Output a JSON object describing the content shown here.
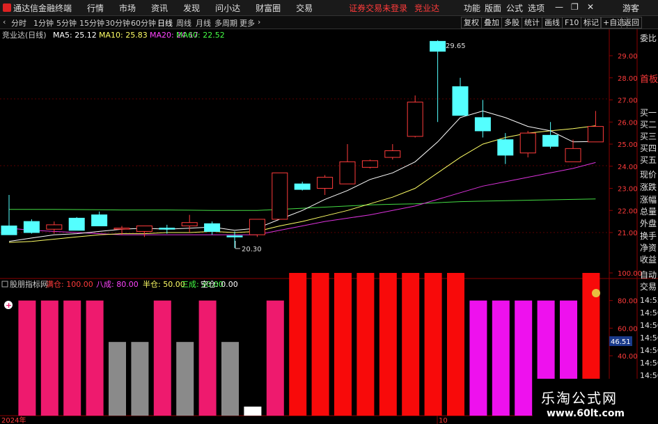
{
  "menubar": {
    "app_title": "通达信金融终端",
    "menus": [
      "行情",
      "市场",
      "资讯",
      "发现",
      "问小达",
      "财富圈",
      "交易"
    ],
    "warning": "证券交易未登录",
    "stock_name": "竞业达",
    "right_menus": [
      "功能",
      "版面",
      "公式",
      "选项"
    ],
    "guest": "游客"
  },
  "toolbar": {
    "periods": [
      "分时",
      "1分钟",
      "5分钟",
      "15分钟",
      "30分钟",
      "60分钟",
      "日线",
      "周线",
      "月线",
      "多周期",
      "更多"
    ],
    "active_period": "日线",
    "right_buttons": [
      "复权",
      "叠加",
      "多股",
      "统计",
      "画线",
      "F10",
      "标记",
      "+自选",
      "返回"
    ]
  },
  "main_chart": {
    "title": "竞业达(日线)",
    "ma": [
      {
        "label": "MA5: 25.12",
        "color": "#ffffff"
      },
      {
        "label": "MA10: 25.83",
        "color": "#ffff66"
      },
      {
        "label": "MA20: 24.17",
        "color": "#ff44ff"
      },
      {
        "label": "MA60: 22.52",
        "color": "#44ff44"
      }
    ],
    "price_ticks": [
      "29.00",
      "28.00",
      "27.00",
      "26.00",
      "25.00",
      "24.00",
      "23.00",
      "22.00",
      "21.00"
    ],
    "high_label": "29.65",
    "low_label": "20.30"
  },
  "indicator": {
    "name": "股朋指标网",
    "items": [
      {
        "label": "满仓: 100.00",
        "color": "#ff3b3b"
      },
      {
        "label": "八成: 80.00",
        "color": "#ff44ff"
      },
      {
        "label": "半仓: 50.00",
        "color": "#ffff66"
      },
      {
        "label": "三成: 30.00",
        "color": "#44ff44"
      },
      {
        "label": "空仓: 0.00",
        "color": "#ffffff"
      }
    ],
    "ticks": [
      "100.00",
      "80.00",
      "60.00",
      "40.00"
    ],
    "current_value": "46.51",
    "bars": [
      80,
      80,
      80,
      80,
      50,
      50,
      80,
      50,
      80,
      50,
      4,
      80,
      100,
      100,
      100,
      100,
      100,
      100,
      100,
      100,
      80,
      80,
      80,
      80,
      80,
      100
    ],
    "bar_colors": [
      "#ee1a6e",
      "#ee1a6e",
      "#ee1a6e",
      "#ee1a6e",
      "#8a8a8a",
      "#8a8a8a",
      "#ee1a6e",
      "#8a8a8a",
      "#ee1a6e",
      "#8a8a8a",
      "#ffffff",
      "#ee1a6e",
      "#f80a0a",
      "#f80a0a",
      "#f80a0a",
      "#f80a0a",
      "#f80a0a",
      "#f80a0a",
      "#f80a0a",
      "#f80a0a",
      "#ee11ee",
      "#ee11ee",
      "#ee11ee",
      "#ee11ee",
      "#ee11ee",
      "#f80a0a"
    ]
  },
  "xaxis": {
    "left_label": "2024年",
    "mid_label": "10"
  },
  "right_panel": {
    "top_labels": [
      "委比",
      "首板"
    ],
    "labels": [
      "买一",
      "买二",
      "买三",
      "买四",
      "买五",
      "现价",
      "涨跌",
      "涨幅",
      "总量",
      "外盘",
      "换手",
      "净资",
      "收益"
    ],
    "auto_trade": [
      "自动",
      "交易"
    ],
    "times": [
      "14:55",
      "14:56",
      "14:56",
      "14:56",
      "14:56",
      "14:56",
      "14:56",
      "14:56",
      "14:56"
    ]
  },
  "watermark": {
    "title": "乐淘公式网",
    "url": "www.60lt.com"
  },
  "chart_data": {
    "type": "candlestick",
    "candles": [
      {
        "o": 21.3,
        "h": 22.7,
        "l": 20.9,
        "c": 20.9
      },
      {
        "o": 21.5,
        "h": 21.6,
        "l": 20.95,
        "c": 21.0
      },
      {
        "o": 21.15,
        "h": 21.5,
        "l": 20.95,
        "c": 21.35
      },
      {
        "o": 21.65,
        "h": 21.7,
        "l": 21.1,
        "c": 21.1
      },
      {
        "o": 21.8,
        "h": 21.95,
        "l": 21.3,
        "c": 21.3
      },
      {
        "o": 21.2,
        "h": 21.3,
        "l": 20.9,
        "c": 21.2
      },
      {
        "o": 21.05,
        "h": 21.3,
        "l": 20.8,
        "c": 21.3
      },
      {
        "o": 21.2,
        "h": 21.35,
        "l": 20.95,
        "c": 21.15
      },
      {
        "o": 21.3,
        "h": 21.8,
        "l": 21.0,
        "c": 21.45
      },
      {
        "o": 21.4,
        "h": 21.5,
        "l": 20.9,
        "c": 21.05
      },
      {
        "o": 20.85,
        "h": 21.05,
        "l": 20.3,
        "c": 20.8
      },
      {
        "o": 20.9,
        "h": 21.5,
        "l": 20.8,
        "c": 21.6
      },
      {
        "o": 21.6,
        "h": 23.7,
        "l": 21.6,
        "c": 23.7
      },
      {
        "o": 23.2,
        "h": 23.3,
        "l": 22.9,
        "c": 22.95
      },
      {
        "o": 23.0,
        "h": 23.6,
        "l": 22.7,
        "c": 23.5
      },
      {
        "o": 23.2,
        "h": 25.0,
        "l": 23.2,
        "c": 24.2
      },
      {
        "o": 23.95,
        "h": 24.3,
        "l": 23.9,
        "c": 24.25
      },
      {
        "o": 24.4,
        "h": 25.0,
        "l": 24.3,
        "c": 24.7
      },
      {
        "o": 25.35,
        "h": 27.2,
        "l": 25.3,
        "c": 26.9
      },
      {
        "o": 29.65,
        "h": 29.7,
        "l": 26.0,
        "c": 29.2
      },
      {
        "o": 27.6,
        "h": 28.0,
        "l": 26.3,
        "c": 26.3
      },
      {
        "o": 26.2,
        "h": 27.0,
        "l": 25.3,
        "c": 25.6
      },
      {
        "o": 25.2,
        "h": 25.5,
        "l": 24.1,
        "c": 24.5
      },
      {
        "o": 24.6,
        "h": 25.6,
        "l": 24.4,
        "c": 25.5
      },
      {
        "o": 25.4,
        "h": 26.0,
        "l": 24.8,
        "c": 24.9
      },
      {
        "o": 24.2,
        "h": 25.2,
        "l": 24.2,
        "c": 24.8
      },
      {
        "o": 25.1,
        "h": 26.5,
        "l": 25.1,
        "c": 25.8
      }
    ],
    "ma5": [
      20.6,
      20.75,
      20.9,
      20.95,
      21.05,
      21.15,
      21.2,
      21.15,
      21.2,
      21.25,
      21.1,
      21.2,
      21.6,
      22.0,
      22.5,
      22.9,
      23.4,
      23.7,
      24.2,
      25.1,
      26.2,
      26.5,
      26.2,
      25.8,
      25.6,
      25.1,
      25.12
    ],
    "ma10": [
      20.55,
      20.6,
      20.7,
      20.8,
      20.9,
      20.95,
      20.95,
      21.0,
      21.0,
      21.05,
      21.0,
      21.05,
      21.3,
      21.5,
      21.75,
      22.0,
      22.3,
      22.6,
      23.0,
      23.7,
      24.4,
      25.0,
      25.3,
      25.5,
      25.6,
      25.7,
      25.83
    ],
    "ma20": [
      21.2,
      21.1,
      21.05,
      21.0,
      20.95,
      20.9,
      20.9,
      20.9,
      20.9,
      20.9,
      20.9,
      20.9,
      21.1,
      21.3,
      21.5,
      21.65,
      21.8,
      22.0,
      22.2,
      22.5,
      22.8,
      23.1,
      23.3,
      23.5,
      23.7,
      23.9,
      24.17
    ],
    "ma60": [
      22.05,
      22.05,
      22.05,
      22.04,
      22.03,
      22.02,
      22.02,
      22.02,
      22.01,
      22.0,
      22.0,
      22.0,
      22.05,
      22.1,
      22.15,
      22.2,
      22.25,
      22.28,
      22.3,
      22.35,
      22.4,
      22.42,
      22.44,
      22.46,
      22.48,
      22.5,
      22.52
    ],
    "ylim": [
      20.2,
      29.9
    ]
  }
}
